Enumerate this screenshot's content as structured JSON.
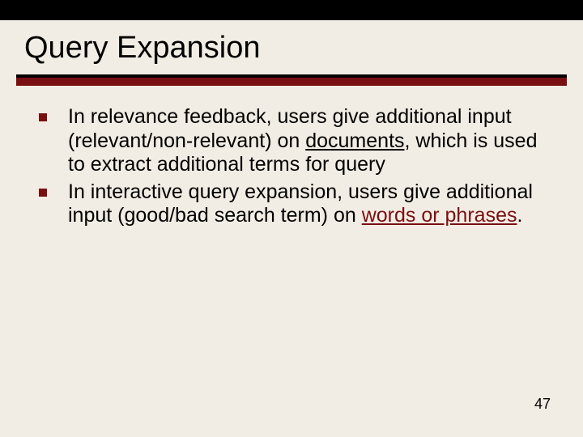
{
  "title": "Query Expansion",
  "bullets": [
    {
      "pre": "In relevance feedback, users give additional input (relevant/non-relevant) on ",
      "u": "documents",
      "post": ", which is used to extract additional terms for query"
    },
    {
      "pre": "In interactive query expansion, users give additional input (good/bad search term) on ",
      "r": "words or phrases",
      "post": "."
    }
  ],
  "page": "47"
}
